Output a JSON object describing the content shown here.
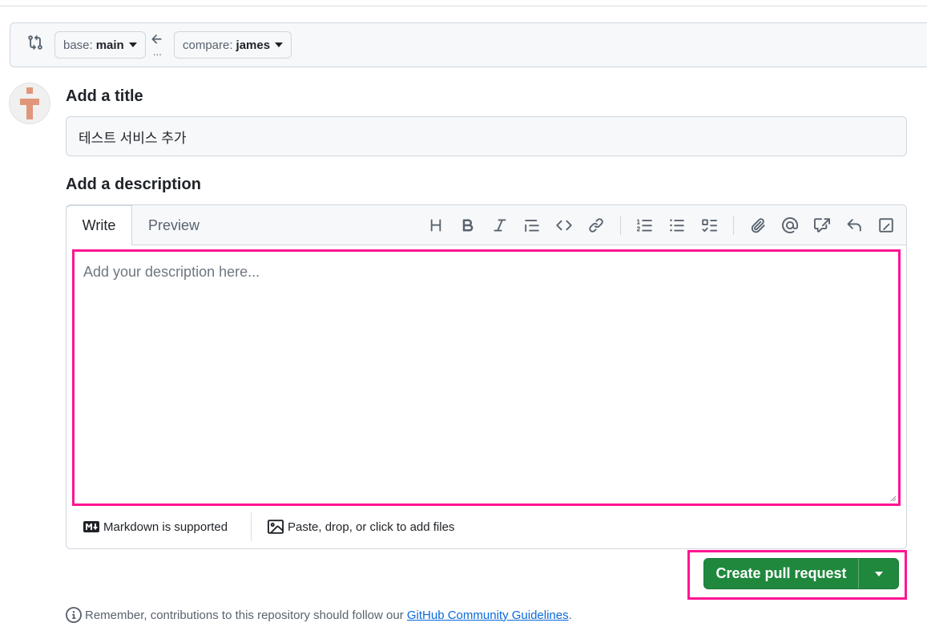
{
  "range": {
    "base_prefix": "base:",
    "base_branch": "main",
    "compare_prefix": "compare:",
    "compare_branch": "james",
    "dots": "..."
  },
  "form": {
    "title_label": "Add a title",
    "title_value": "테스트 서비스 추가",
    "description_label": "Add a description"
  },
  "editor": {
    "tabs": [
      "Write",
      "Preview"
    ],
    "placeholder": "Add your description here...",
    "toolbar_icons": [
      "heading-icon",
      "bold-icon",
      "italic-icon",
      "quote-icon",
      "code-icon",
      "link-icon",
      "numbered-list-icon",
      "unordered-list-icon",
      "task-list-icon",
      "attach-icon",
      "mention-icon",
      "reference-icon",
      "reply-icon",
      "slash-commands-icon"
    ],
    "markdown_note": "Markdown is supported",
    "files_note": "Paste, drop, or click to add files"
  },
  "submit": {
    "label": "Create pull request"
  },
  "footer": {
    "prefix": "Remember, contributions to this repository should follow our",
    "link": "GitHub Community Guidelines",
    "suffix": "."
  },
  "colors": {
    "primary_button": "#1f883d",
    "highlight": "#ff1493",
    "link": "#0969da"
  }
}
